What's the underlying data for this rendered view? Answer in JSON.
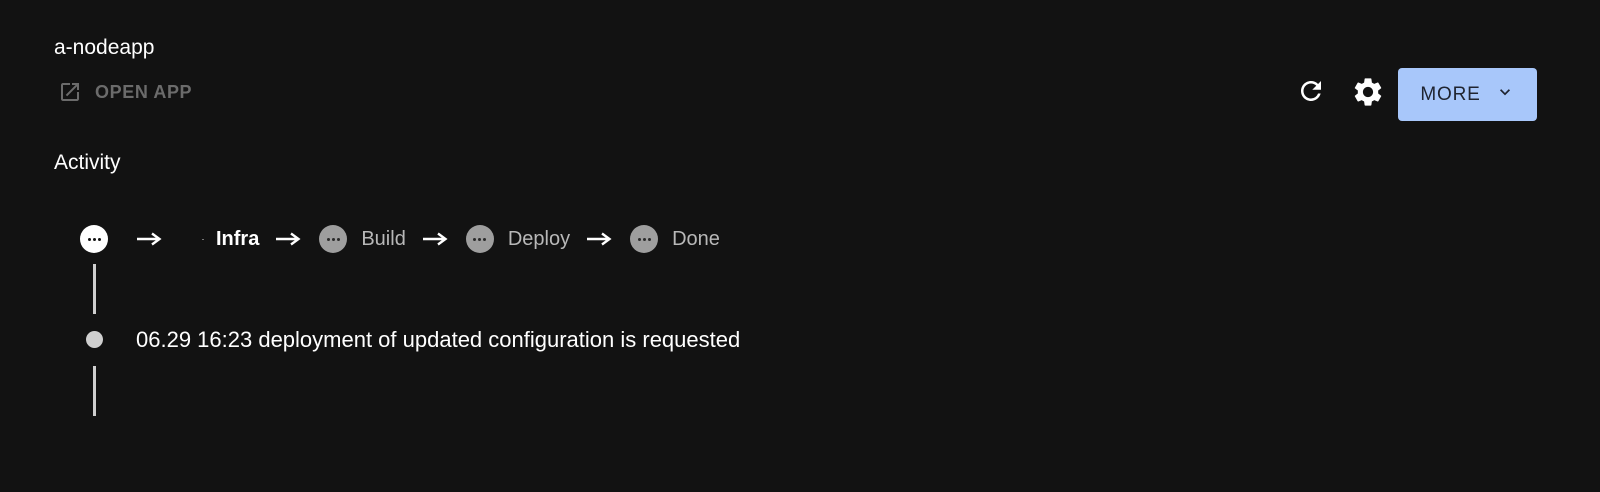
{
  "app": {
    "title": "a-nodeapp",
    "open_app_label": "OPEN APP"
  },
  "toolbar": {
    "refresh_icon": "refresh-icon",
    "settings_icon": "gear-icon",
    "more_label": "MORE"
  },
  "activity": {
    "title": "Activity",
    "steps": [
      {
        "label": "",
        "state": "active"
      },
      {
        "label": "Infra",
        "state": "current"
      },
      {
        "label": "Build",
        "state": "pending"
      },
      {
        "label": "Deploy",
        "state": "pending"
      },
      {
        "label": "Done",
        "state": "pending"
      }
    ],
    "events": [
      {
        "text": "06.29 16:23 deployment of updated configuration is requested"
      }
    ]
  },
  "colors": {
    "background": "#121212",
    "accent_button": "#a8c7fa",
    "disabled_text": "#6b6b6b",
    "pending_step": "#9e9e9e",
    "timeline": "#cfcfcf"
  }
}
